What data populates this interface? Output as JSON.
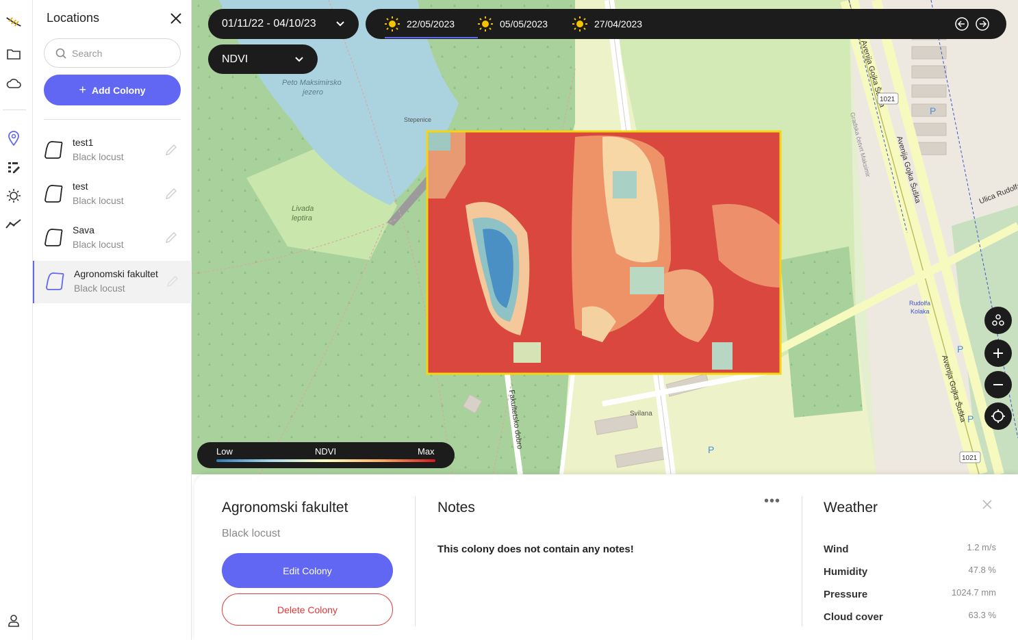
{
  "rail": {
    "icons": [
      "logo-icon",
      "folder-icon",
      "cloud-icon",
      "location-pin-icon",
      "edit-list-icon",
      "sun-icon",
      "trend-icon",
      "user-icon"
    ]
  },
  "sidebar": {
    "title": "Locations",
    "search_placeholder": "Search",
    "add_button": "Add Colony",
    "items": [
      {
        "name": "test1",
        "species": "Black locust"
      },
      {
        "name": "test",
        "species": "Black locust"
      },
      {
        "name": "Sava",
        "species": "Black locust"
      },
      {
        "name": "Agronomski fakultet",
        "species": "Black locust"
      }
    ]
  },
  "map": {
    "date_range": "01/11/22 - 04/10/23",
    "index": "NDVI",
    "dates": [
      "22/05/2023",
      "05/05/2023",
      "27/04/2023"
    ],
    "legend": {
      "low": "Low",
      "title": "NDVI",
      "high": "Max"
    },
    "labels": {
      "lake": [
        "Peto Maksimirsko",
        "jezero"
      ],
      "stepenice": "Stepenice",
      "meadow": [
        "Livada",
        "leptira"
      ],
      "fakultetsko": "Fakultetsko dobro",
      "svilana": "Svilana",
      "avenija": "Avenija Gojka Šuška",
      "road_1021": "1021",
      "ulica": "Ulica Rudolfa",
      "rudolfa": [
        "Rudolfa",
        "Kolaka"
      ],
      "gradska": "Gradska četvrt Maksimir",
      "parking": "P"
    }
  },
  "card": {
    "title": "Agronomski fakultet",
    "species": "Black locust",
    "edit_button": "Edit Colony",
    "delete_button": "Delete Colony",
    "notes_title": "Notes",
    "notes_more": "•••",
    "notes_text": "This colony does not contain any notes!",
    "weather_title": "Weather",
    "weather": [
      {
        "label": "Wind",
        "value": "1.2 m/s"
      },
      {
        "label": "Humidity",
        "value": "47.8 %"
      },
      {
        "label": "Pressure",
        "value": "1024.7 mm"
      },
      {
        "label": "Cloud cover",
        "value": "63.3 %"
      }
    ]
  },
  "colors": {
    "accent": "#6167f2",
    "danger": "#e03535",
    "pill_bg": "#1c1c1c"
  }
}
